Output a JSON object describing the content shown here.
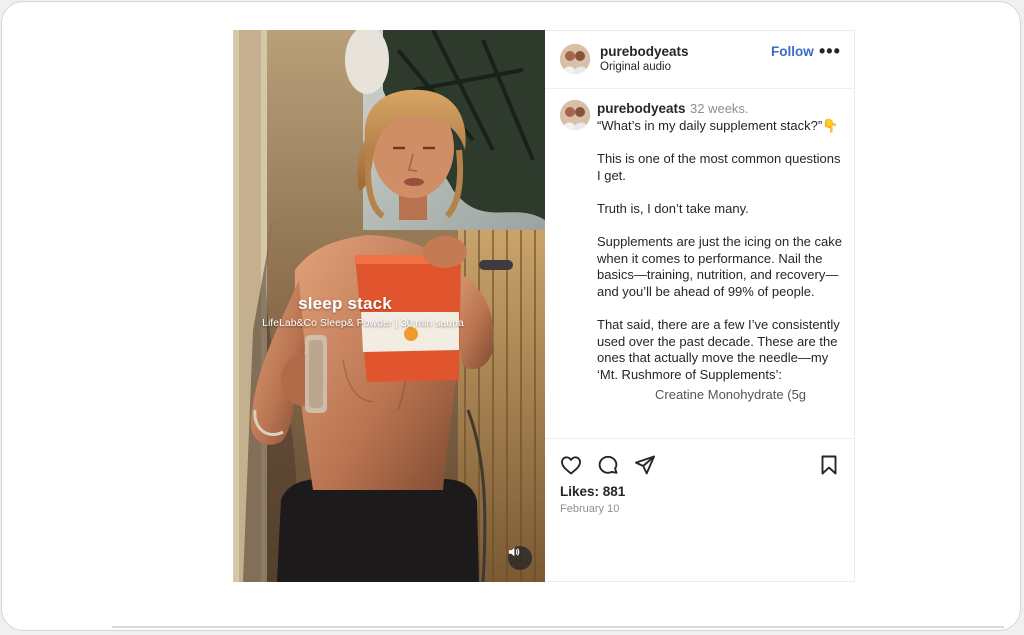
{
  "post": {
    "username": "purebodyeats",
    "audio": "Original audio",
    "follow_label": "Follow",
    "more_label": "•••",
    "overlay_title": "sleep stack",
    "overlay_subtitle": "LifeLab&Co Sleep& Powder | 30 min sauna",
    "caption": {
      "username": "purebodyeats",
      "timestamp": "32 weeks.",
      "lines": [
        "“What’s in my daily supplement stack?”👇",
        "This is one of the most common questions I get.",
        "Truth is, I don’t take many.",
        "Supplements are just the icing on the cake when it comes to performance. Nail the basics—training, nutrition, and recovery—and you’ll be ahead of 99% of people.",
        "That said, there are a few I’ve consistently used over the past decade. These are the ones that actually move the needle—my ‘Mt. Rushmore of Supplements’:"
      ],
      "clipped_line": "Creatine Monohydrate (5g"
    },
    "likes": "Likes: 881",
    "date": "February 10"
  },
  "icons": [
    "heart-icon",
    "comment-icon",
    "share-icon",
    "bookmark-icon",
    "speaker-icon",
    "more-icon"
  ],
  "colors": {
    "follow": "#3a6bc4",
    "text": "#262626",
    "muted": "#8e8e8e"
  }
}
